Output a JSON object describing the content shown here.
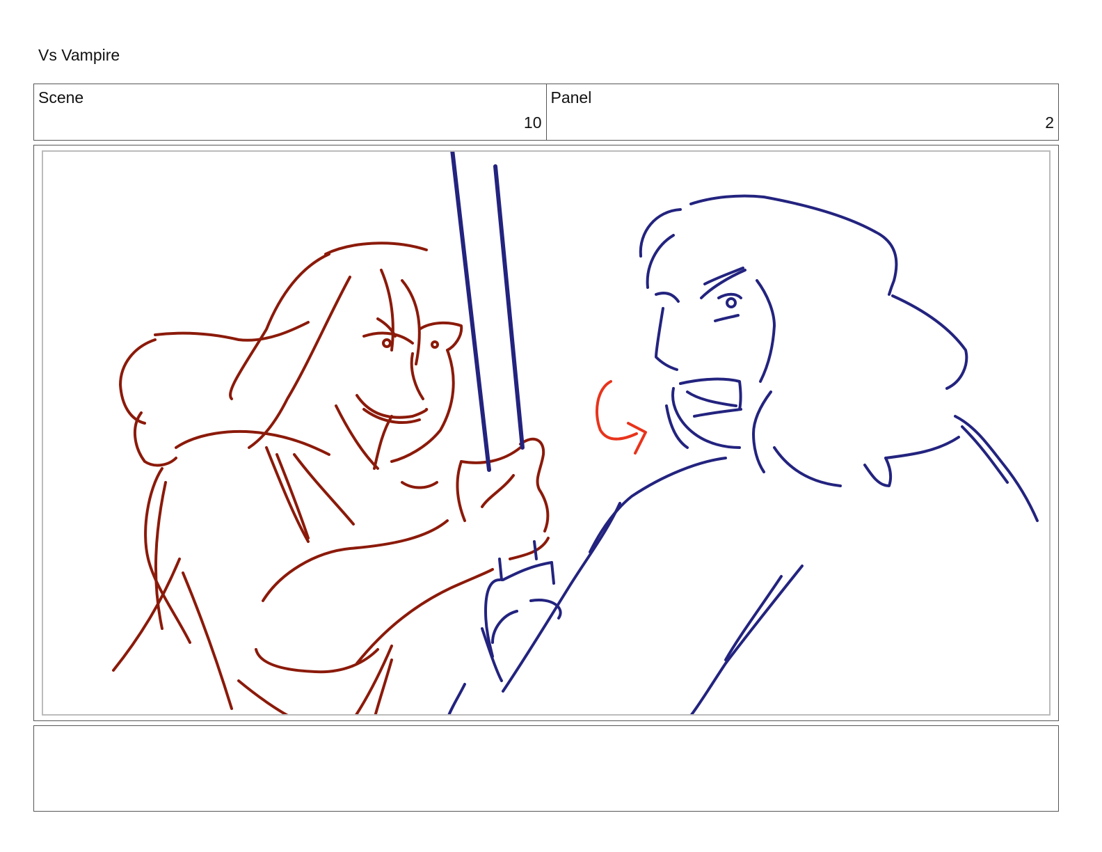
{
  "document": {
    "title": "Vs Vampire"
  },
  "header": {
    "scene_label": "Scene",
    "scene_value": "10",
    "panel_label": "Panel",
    "panel_value": "2"
  },
  "notes": {
    "text": ""
  },
  "colors": {
    "vampire_sketch": "#8b1a0a",
    "hero_sketch": "#23237f",
    "motion_arrow": "#e8341c",
    "frame_border": "#555555"
  }
}
